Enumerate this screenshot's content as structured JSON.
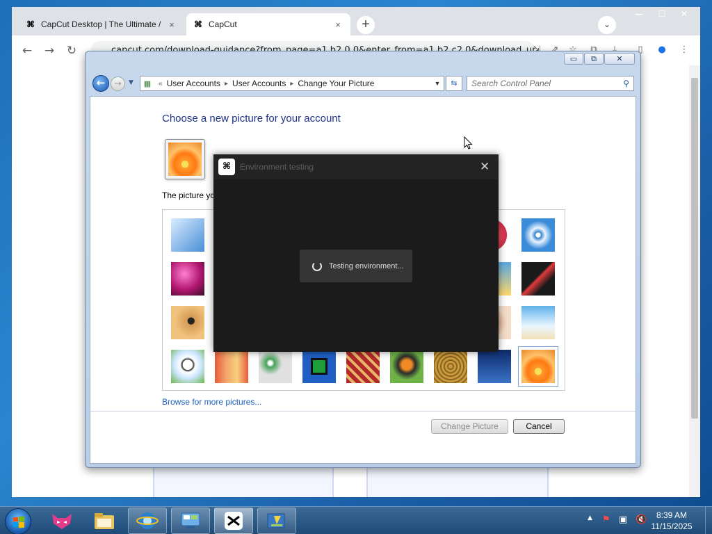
{
  "browser": {
    "tabs": [
      {
        "label": "CapCut Desktop | The Ultimate /",
        "close": "×"
      },
      {
        "label": "CapCut",
        "close": "×"
      }
    ],
    "new_tab": "+",
    "tab_search": "⌄",
    "window_controls": {
      "minimize": "—",
      "maximize": "☐",
      "close": "✕"
    },
    "url": "capcut.com/download-guidance?from_page=a1.b2.0.0&enter_from=a1.b2.c2.0&download_url",
    "nav": {
      "back": "←",
      "forward": "→",
      "reload": "↻"
    },
    "menu": "⋮"
  },
  "control_panel": {
    "title_buttons": {
      "minimize": "▭",
      "maximize": "⧉",
      "close": "✕"
    },
    "breadcrumb": {
      "prefix": "«",
      "items": [
        "User Accounts",
        "User Accounts",
        "Change Your Picture"
      ],
      "separator": "▸"
    },
    "search_placeholder": "Search Control Panel",
    "heading": "Choose a new picture for your account",
    "picture_text": "The picture yo",
    "browse_link": "Browse for more pictures...",
    "change_button": "Change Picture",
    "cancel_button": "Cancel",
    "pictures": [
      "roller-coaster",
      "hidden",
      "hidden",
      "hidden",
      "hidden",
      "hidden",
      "hidden",
      "flower-red",
      "ferris-wheel",
      "bowling-ball",
      "hidden",
      "hidden",
      "hidden",
      "hidden",
      "hidden",
      "hidden",
      "beach-chair",
      "origami-crane",
      "guitar",
      "hidden",
      "hidden",
      "hidden",
      "hidden",
      "hidden",
      "hidden",
      "shell",
      "sailboat",
      "soccer-ball",
      "fabric",
      "marbles",
      "window-art",
      "textile",
      "butterfly",
      "wicker",
      "lighthouse",
      "orange-flower"
    ],
    "selected_picture": "orange-flower"
  },
  "capcut_dialog": {
    "title": "Environment testing",
    "close": "✕",
    "status": "Testing environment..."
  },
  "taskbar": {
    "time": "8:39 AM",
    "date": "11/15/2025",
    "tray_arrow": "▲"
  }
}
